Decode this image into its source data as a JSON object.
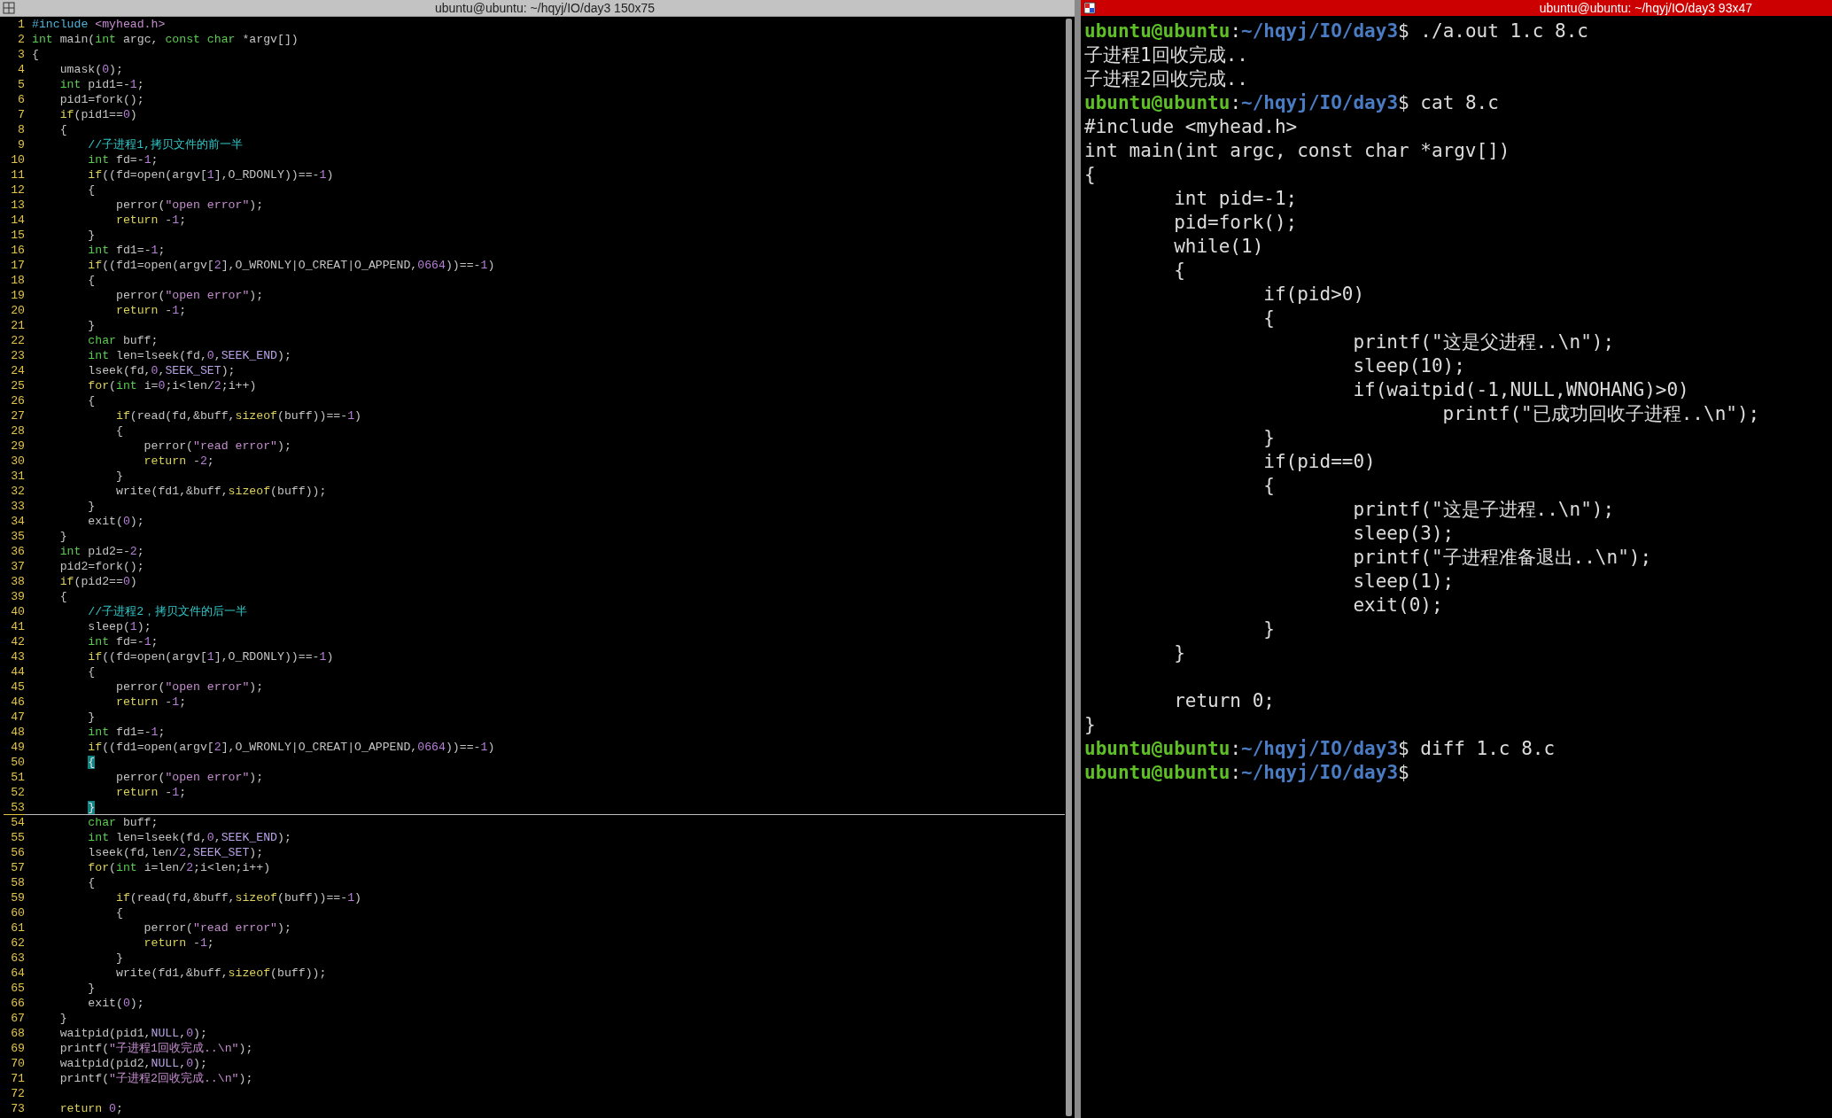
{
  "left_terminal": {
    "title": "ubuntu@ubuntu: ~/hqyj/IO/day3 150x75",
    "lines": [
      {
        "number": "1",
        "current": false,
        "segments": [
          {
            "text": "#include",
            "kind": "pre"
          },
          {
            "text": " <myhead.h>",
            "kind": "str"
          }
        ]
      },
      {
        "number": "2",
        "current": false,
        "segments": [
          {
            "text": "int",
            "kind": "kw"
          },
          " main(",
          {
            "text": "int",
            "kind": "kw"
          },
          " argc, ",
          {
            "text": "const char",
            "kind": "kw"
          },
          " *argv[])"
        ]
      },
      {
        "number": "3",
        "current": false,
        "segments": [
          "{"
        ]
      },
      {
        "number": "4",
        "current": false,
        "segments": [
          "    umask(",
          {
            "text": "0",
            "kind": "num"
          },
          ");"
        ]
      },
      {
        "number": "5",
        "current": false,
        "segments": [
          {
            "text": "    int",
            "kind": "kw"
          },
          " pid1=-",
          {
            "text": "1",
            "kind": "num"
          },
          ";"
        ]
      },
      {
        "number": "6",
        "current": false,
        "segments": [
          "    pid1=fork();"
        ]
      },
      {
        "number": "7",
        "current": false,
        "segments": [
          {
            "text": "    if",
            "kind": "ctl"
          },
          "(pid1==",
          {
            "text": "0",
            "kind": "num"
          },
          ")"
        ]
      },
      {
        "number": "8",
        "current": false,
        "segments": [
          "    {"
        ]
      },
      {
        "number": "9",
        "current": false,
        "segments": [
          {
            "text": "        //子进程1,拷贝文件的前一半",
            "kind": "cmt"
          }
        ]
      },
      {
        "number": "10",
        "current": false,
        "segments": [
          {
            "text": "        int",
            "kind": "kw"
          },
          " fd=-",
          {
            "text": "1",
            "kind": "num"
          },
          ";"
        ]
      },
      {
        "number": "11",
        "current": false,
        "segments": [
          {
            "text": "        if",
            "kind": "ctl"
          },
          "((fd=open(argv[",
          {
            "text": "1",
            "kind": "num"
          },
          "],O_RDONLY))==-",
          {
            "text": "1",
            "kind": "num"
          },
          ")"
        ]
      },
      {
        "number": "12",
        "current": false,
        "segments": [
          "        {"
        ]
      },
      {
        "number": "13",
        "current": false,
        "segments": [
          "            perror(",
          {
            "text": "\"open error\"",
            "kind": "str"
          },
          ");"
        ]
      },
      {
        "number": "14",
        "current": false,
        "segments": [
          {
            "text": "            return",
            "kind": "ctl"
          },
          " -",
          {
            "text": "1",
            "kind": "num"
          },
          ";"
        ]
      },
      {
        "number": "15",
        "current": false,
        "segments": [
          "        }"
        ]
      },
      {
        "number": "16",
        "current": false,
        "segments": [
          {
            "text": "        int",
            "kind": "kw"
          },
          " fd1=-",
          {
            "text": "1",
            "kind": "num"
          },
          ";"
        ]
      },
      {
        "number": "17",
        "current": false,
        "segments": [
          {
            "text": "        if",
            "kind": "ctl"
          },
          "((fd1=open(argv[",
          {
            "text": "2",
            "kind": "num"
          },
          "],O_WRONLY|O_CREAT|O_APPEND,",
          {
            "text": "0664",
            "kind": "num"
          },
          "))==-",
          {
            "text": "1",
            "kind": "num"
          },
          ")"
        ]
      },
      {
        "number": "18",
        "current": false,
        "segments": [
          "        {"
        ]
      },
      {
        "number": "19",
        "current": false,
        "segments": [
          "            perror(",
          {
            "text": "\"open error\"",
            "kind": "str"
          },
          ");"
        ]
      },
      {
        "number": "20",
        "current": false,
        "segments": [
          {
            "text": "            return",
            "kind": "ctl"
          },
          " -",
          {
            "text": "1",
            "kind": "num"
          },
          ";"
        ]
      },
      {
        "number": "21",
        "current": false,
        "segments": [
          "        }"
        ]
      },
      {
        "number": "22",
        "current": false,
        "segments": [
          {
            "text": "        char",
            "kind": "kw"
          },
          " buff;"
        ]
      },
      {
        "number": "23",
        "current": false,
        "segments": [
          {
            "text": "        int",
            "kind": "kw"
          },
          " len=lseek(fd,",
          {
            "text": "0",
            "kind": "num"
          },
          ",",
          {
            "text": "SEEK_END",
            "kind": "const"
          },
          ");"
        ]
      },
      {
        "number": "24",
        "current": false,
        "segments": [
          "        lseek(fd,",
          {
            "text": "0",
            "kind": "num"
          },
          ",",
          {
            "text": "SEEK_SET",
            "kind": "const"
          },
          ");"
        ]
      },
      {
        "number": "25",
        "current": false,
        "segments": [
          {
            "text": "        for",
            "kind": "ctl"
          },
          "(",
          {
            "text": "int",
            "kind": "kw"
          },
          " i=",
          {
            "text": "0",
            "kind": "num"
          },
          ";i<len/",
          {
            "text": "2",
            "kind": "num"
          },
          ";i++)"
        ]
      },
      {
        "number": "26",
        "current": false,
        "segments": [
          "        {"
        ]
      },
      {
        "number": "27",
        "current": false,
        "segments": [
          {
            "text": "            if",
            "kind": "ctl"
          },
          "(read(fd,&buff,",
          {
            "text": "sizeof",
            "kind": "ctl"
          },
          "(buff))==-",
          {
            "text": "1",
            "kind": "num"
          },
          ")"
        ]
      },
      {
        "number": "28",
        "current": false,
        "segments": [
          "            {"
        ]
      },
      {
        "number": "29",
        "current": false,
        "segments": [
          "                perror(",
          {
            "text": "\"read error\"",
            "kind": "str"
          },
          ");"
        ]
      },
      {
        "number": "30",
        "current": false,
        "segments": [
          {
            "text": "                return",
            "kind": "ctl"
          },
          " -",
          {
            "text": "2",
            "kind": "num"
          },
          ";"
        ]
      },
      {
        "number": "31",
        "current": false,
        "segments": [
          "            }"
        ]
      },
      {
        "number": "32",
        "current": false,
        "segments": [
          "            write(fd1,&buff,",
          {
            "text": "sizeof",
            "kind": "ctl"
          },
          "(buff));"
        ]
      },
      {
        "number": "33",
        "current": false,
        "segments": [
          "        }"
        ]
      },
      {
        "number": "34",
        "current": false,
        "segments": [
          "        exit(",
          {
            "text": "0",
            "kind": "num"
          },
          ");"
        ]
      },
      {
        "number": "35",
        "current": false,
        "segments": [
          "    }"
        ]
      },
      {
        "number": "36",
        "current": false,
        "segments": [
          {
            "text": "    int",
            "kind": "kw"
          },
          " pid2=-",
          {
            "text": "2",
            "kind": "num"
          },
          ";"
        ]
      },
      {
        "number": "37",
        "current": false,
        "segments": [
          "    pid2=fork();"
        ]
      },
      {
        "number": "38",
        "current": false,
        "segments": [
          {
            "text": "    if",
            "kind": "ctl"
          },
          "(pid2==",
          {
            "text": "0",
            "kind": "num"
          },
          ")"
        ]
      },
      {
        "number": "39",
        "current": false,
        "segments": [
          "    {"
        ]
      },
      {
        "number": "40",
        "current": false,
        "segments": [
          {
            "text": "        //子进程2，拷贝文件的后一半",
            "kind": "cmt"
          }
        ]
      },
      {
        "number": "41",
        "current": false,
        "segments": [
          "        sleep(",
          {
            "text": "1",
            "kind": "num"
          },
          ");"
        ]
      },
      {
        "number": "42",
        "current": false,
        "segments": [
          {
            "text": "        int",
            "kind": "kw"
          },
          " fd=-",
          {
            "text": "1",
            "kind": "num"
          },
          ";"
        ]
      },
      {
        "number": "43",
        "current": false,
        "segments": [
          {
            "text": "        if",
            "kind": "ctl"
          },
          "((fd=open(argv[",
          {
            "text": "1",
            "kind": "num"
          },
          "],O_RDONLY))==-",
          {
            "text": "1",
            "kind": "num"
          },
          ")"
        ]
      },
      {
        "number": "44",
        "current": false,
        "segments": [
          "        {"
        ]
      },
      {
        "number": "45",
        "current": false,
        "segments": [
          "            perror(",
          {
            "text": "\"open error\"",
            "kind": "str"
          },
          ");"
        ]
      },
      {
        "number": "46",
        "current": false,
        "segments": [
          {
            "text": "            return",
            "kind": "ctl"
          },
          " -",
          {
            "text": "1",
            "kind": "num"
          },
          ";"
        ]
      },
      {
        "number": "47",
        "current": false,
        "segments": [
          "        }"
        ]
      },
      {
        "number": "48",
        "current": false,
        "segments": [
          {
            "text": "        int",
            "kind": "kw"
          },
          " fd1=-",
          {
            "text": "1",
            "kind": "num"
          },
          ";"
        ]
      },
      {
        "number": "49",
        "current": false,
        "segments": [
          {
            "text": "        if",
            "kind": "ctl"
          },
          "((fd1=open(argv[",
          {
            "text": "2",
            "kind": "num"
          },
          "],O_WRONLY|O_CREAT|O_APPEND,",
          {
            "text": "0664",
            "kind": "num"
          },
          "))==-",
          {
            "text": "1",
            "kind": "num"
          },
          ")"
        ]
      },
      {
        "number": "50",
        "current": false,
        "segments": [
          {
            "text": "        {",
            "kind": "match"
          }
        ]
      },
      {
        "number": "51",
        "current": false,
        "segments": [
          "            perror(",
          {
            "text": "\"open error\"",
            "kind": "str"
          },
          ");"
        ]
      },
      {
        "number": "52",
        "current": false,
        "segments": [
          {
            "text": "            return",
            "kind": "ctl"
          },
          " -",
          {
            "text": "1",
            "kind": "num"
          },
          ";"
        ]
      },
      {
        "number": "53",
        "current": true,
        "segments": [
          {
            "text": "        }",
            "kind": "match"
          }
        ]
      },
      {
        "number": "54",
        "current": false,
        "segments": [
          {
            "text": "        char",
            "kind": "kw"
          },
          " buff;"
        ]
      },
      {
        "number": "55",
        "current": false,
        "segments": [
          {
            "text": "        int",
            "kind": "kw"
          },
          " len=lseek(fd,",
          {
            "text": "0",
            "kind": "num"
          },
          ",",
          {
            "text": "SEEK_END",
            "kind": "const"
          },
          ");"
        ]
      },
      {
        "number": "56",
        "current": false,
        "segments": [
          "        lseek(fd,len/",
          {
            "text": "2",
            "kind": "num"
          },
          ",",
          {
            "text": "SEEK_SET",
            "kind": "const"
          },
          ");"
        ]
      },
      {
        "number": "57",
        "current": false,
        "segments": [
          {
            "text": "        for",
            "kind": "ctl"
          },
          "(",
          {
            "text": "int",
            "kind": "kw"
          },
          " i=len/",
          {
            "text": "2",
            "kind": "num"
          },
          ";i<len;i++)"
        ]
      },
      {
        "number": "58",
        "current": false,
        "segments": [
          "        {"
        ]
      },
      {
        "number": "59",
        "current": false,
        "segments": [
          {
            "text": "            if",
            "kind": "ctl"
          },
          "(read(fd,&buff,",
          {
            "text": "sizeof",
            "kind": "ctl"
          },
          "(buff))==-",
          {
            "text": "1",
            "kind": "num"
          },
          ")"
        ]
      },
      {
        "number": "60",
        "current": false,
        "segments": [
          "            {"
        ]
      },
      {
        "number": "61",
        "current": false,
        "segments": [
          "                perror(",
          {
            "text": "\"read error\"",
            "kind": "str"
          },
          ");"
        ]
      },
      {
        "number": "62",
        "current": false,
        "segments": [
          {
            "text": "                return",
            "kind": "ctl"
          },
          " -",
          {
            "text": "1",
            "kind": "num"
          },
          ";"
        ]
      },
      {
        "number": "63",
        "current": false,
        "segments": [
          "            }"
        ]
      },
      {
        "number": "64",
        "current": false,
        "segments": [
          "            write(fd1,&buff,",
          {
            "text": "sizeof",
            "kind": "ctl"
          },
          "(buff));"
        ]
      },
      {
        "number": "65",
        "current": false,
        "segments": [
          "        }"
        ]
      },
      {
        "number": "66",
        "current": false,
        "segments": [
          "        exit(",
          {
            "text": "0",
            "kind": "num"
          },
          ");"
        ]
      },
      {
        "number": "67",
        "current": false,
        "segments": [
          "    }"
        ]
      },
      {
        "number": "68",
        "current": false,
        "segments": [
          "    waitpid(pid1,",
          {
            "text": "NULL",
            "kind": "const"
          },
          ",",
          {
            "text": "0",
            "kind": "num"
          },
          ");"
        ]
      },
      {
        "number": "69",
        "current": false,
        "segments": [
          "    printf(",
          {
            "text": "\"子进程1回收完成..\\n\"",
            "kind": "str"
          },
          ");"
        ]
      },
      {
        "number": "70",
        "current": false,
        "segments": [
          "    waitpid(pid2,",
          {
            "text": "NULL",
            "kind": "const"
          },
          ",",
          {
            "text": "0",
            "kind": "num"
          },
          ");"
        ]
      },
      {
        "number": "71",
        "current": false,
        "segments": [
          "    printf(",
          {
            "text": "\"子进程2回收完成..\\n\"",
            "kind": "str"
          },
          ");"
        ]
      },
      {
        "number": "72",
        "current": false
      },
      {
        "number": "73",
        "current": false,
        "segments": [
          {
            "text": "    return",
            "kind": "ctl"
          },
          {
            "text": " 0",
            "kind": "num"
          },
          ";"
        ]
      }
    ]
  },
  "right_terminal": {
    "title": "ubuntu@ubuntu: ~/hqyj/IO/day3 93x47",
    "lines": [
      {
        "kind": "prompt",
        "user_host": "ubuntu@ubuntu",
        "separator": ":",
        "path": "~/hqyj/IO/day3",
        "sign": "$",
        "command": "./a.out 1.c 8.c"
      },
      {
        "kind": "output",
        "text": "子进程1回收完成.."
      },
      {
        "kind": "output",
        "text": "子进程2回收完成.."
      },
      {
        "kind": "prompt",
        "user_host": "ubuntu@ubuntu",
        "separator": ":",
        "path": "~/hqyj/IO/day3",
        "sign": "$",
        "command": "cat 8.c"
      },
      {
        "kind": "output",
        "text": "#include <myhead.h>"
      },
      {
        "kind": "output",
        "text": "int main(int argc, const char *argv[])"
      },
      {
        "kind": "output",
        "text": "{"
      },
      {
        "kind": "output",
        "text": "        int pid=-1;"
      },
      {
        "kind": "output",
        "text": "        pid=fork();"
      },
      {
        "kind": "output",
        "text": "        while(1)"
      },
      {
        "kind": "output",
        "text": "        {"
      },
      {
        "kind": "output",
        "text": "                if(pid>0)"
      },
      {
        "kind": "output",
        "text": "                {"
      },
      {
        "kind": "output",
        "text": "                        printf(\"这是父进程..\\n\");"
      },
      {
        "kind": "output",
        "text": "                        sleep(10);"
      },
      {
        "kind": "output",
        "text": "                        if(waitpid(-1,NULL,WNOHANG)>0)"
      },
      {
        "kind": "output",
        "text": "                                printf(\"已成功回收子进程..\\n\");"
      },
      {
        "kind": "output",
        "text": "                }"
      },
      {
        "kind": "output",
        "text": "                if(pid==0)"
      },
      {
        "kind": "output",
        "text": "                {"
      },
      {
        "kind": "output",
        "text": "                        printf(\"这是子进程..\\n\");"
      },
      {
        "kind": "output",
        "text": "                        sleep(3);"
      },
      {
        "kind": "output",
        "text": "                        printf(\"子进程准备退出..\\n\");"
      },
      {
        "kind": "output",
        "text": "                        sleep(1);"
      },
      {
        "kind": "output",
        "text": "                        exit(0);"
      },
      {
        "kind": "output",
        "text": "                }"
      },
      {
        "kind": "output",
        "text": "        }"
      },
      {
        "kind": "blank"
      },
      {
        "kind": "output",
        "text": "        return 0;"
      },
      {
        "kind": "output",
        "text": "}"
      },
      {
        "kind": "prompt",
        "user_host": "ubuntu@ubuntu",
        "separator": ":",
        "path": "~/hqyj/IO/day3",
        "sign": "$",
        "command": "diff 1.c 8.c"
      },
      {
        "kind": "prompt",
        "user_host": "ubuntu@ubuntu",
        "separator": ":",
        "path": "~/hqyj/IO/day3",
        "sign": "$"
      }
    ]
  }
}
